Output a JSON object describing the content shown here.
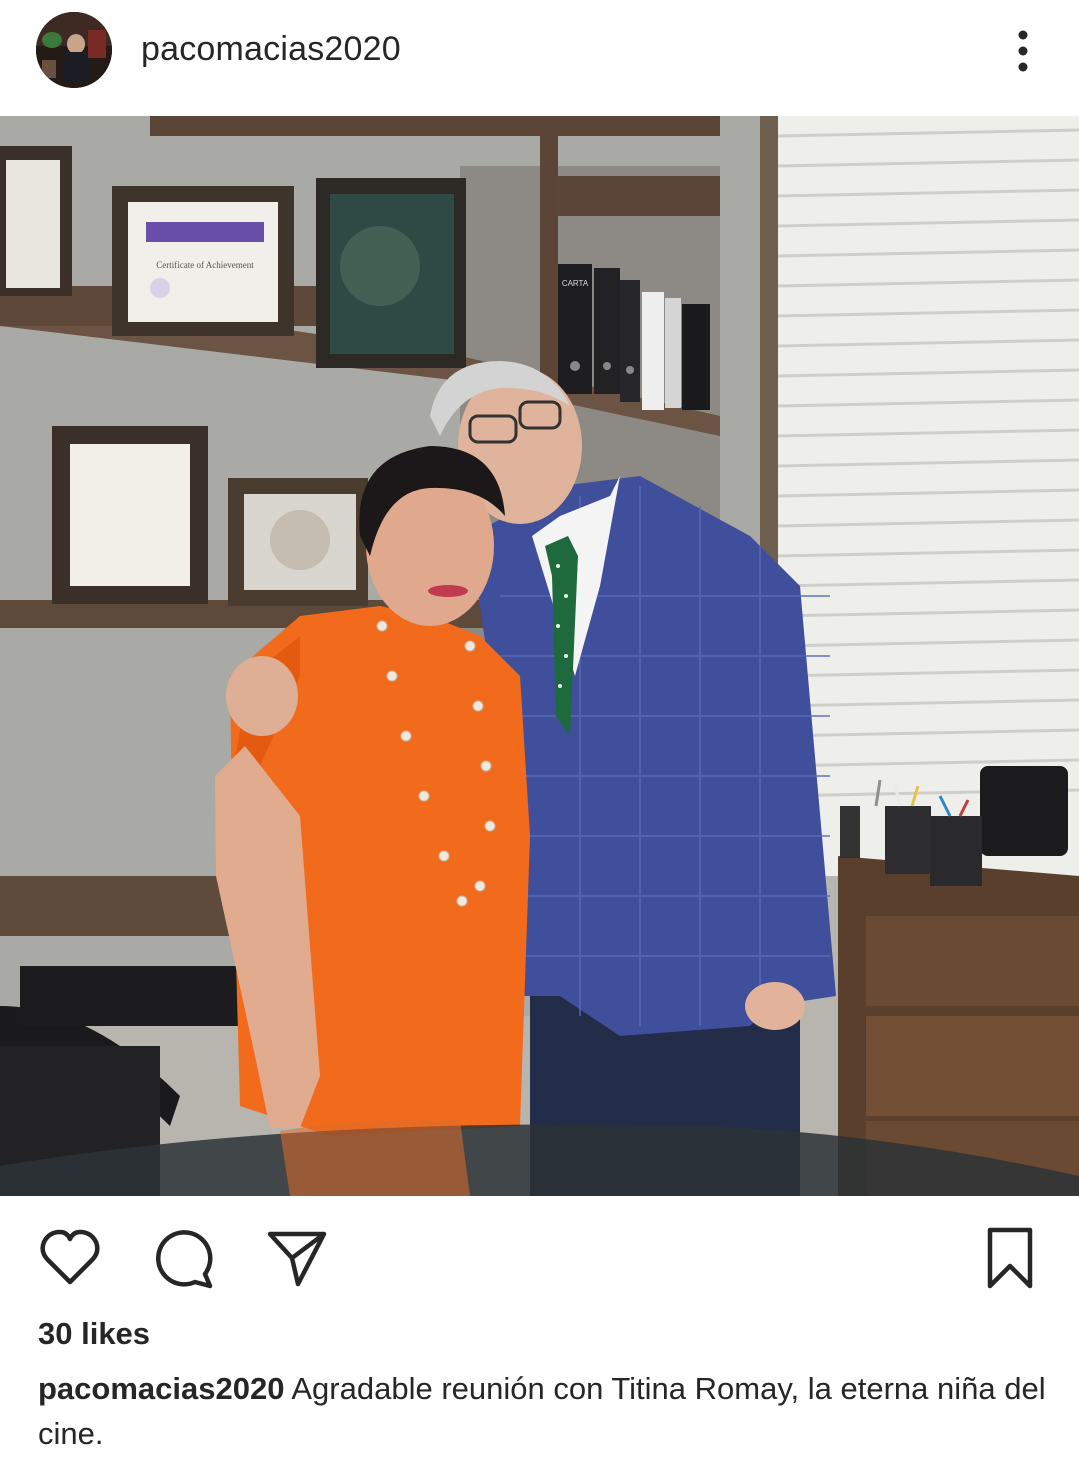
{
  "header": {
    "username": "pacomacias2020",
    "avatar_icon": "profile-avatar",
    "more_icon": "more-vertical-icon"
  },
  "post": {
    "photo_icon": "post-photo"
  },
  "actions": {
    "like_icon": "heart-icon",
    "comment_icon": "comment-icon",
    "share_icon": "send-icon",
    "save_icon": "bookmark-icon"
  },
  "likes": {
    "text": "30 likes"
  },
  "caption": {
    "username": "pacomacias2020",
    "text": "Agradable reunión con Titina Romay, la eterna niña del cine."
  },
  "photo_labels": {
    "certificate_title": "Certificate of Achievement",
    "binder_label": "CARTA"
  },
  "colors": {
    "text": "#262626",
    "background": "#ffffff",
    "blouse": "#f26a1b",
    "blazer": "#3f4f9c"
  }
}
